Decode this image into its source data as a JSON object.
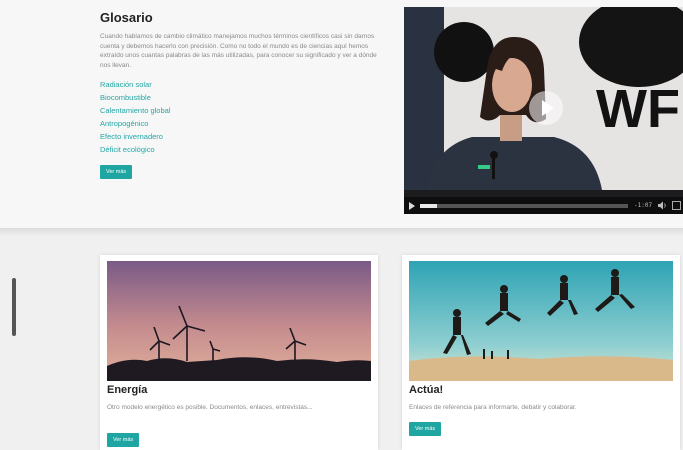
{
  "glossary": {
    "title": "Glosario",
    "intro": "Cuando hablamos de cambio climático manejamos muchos términos científicos casi sin darnos cuenta y debemos hacerlo con precisión. Como no todo el mundo es de ciencias aquí hemos extraído unos cuantas palabras de las más utilizadas, para conocer su significado y ver a dónde nos llevan.",
    "terms": [
      "Radiación solar",
      "Biocombustible",
      "Calentamiento global",
      "Antropogénico",
      "Efecto invernadero",
      "Déficit ecológico"
    ],
    "button": "Ver más"
  },
  "video": {
    "logo_text": "WF",
    "time": "-1:07",
    "progress": 0.08
  },
  "cards": [
    {
      "title": "Energía",
      "description": "Otro modelo energético es posible. Documentos, enlaces, entrevistas...",
      "button": "Ver más"
    },
    {
      "title": "Actúa!",
      "description": "Enlaces de referencia para informarte, debatir y colaborar.",
      "button": "Ver más"
    }
  ],
  "colors": {
    "accent": "#1fa6a3",
    "link": "#23a7a6"
  }
}
